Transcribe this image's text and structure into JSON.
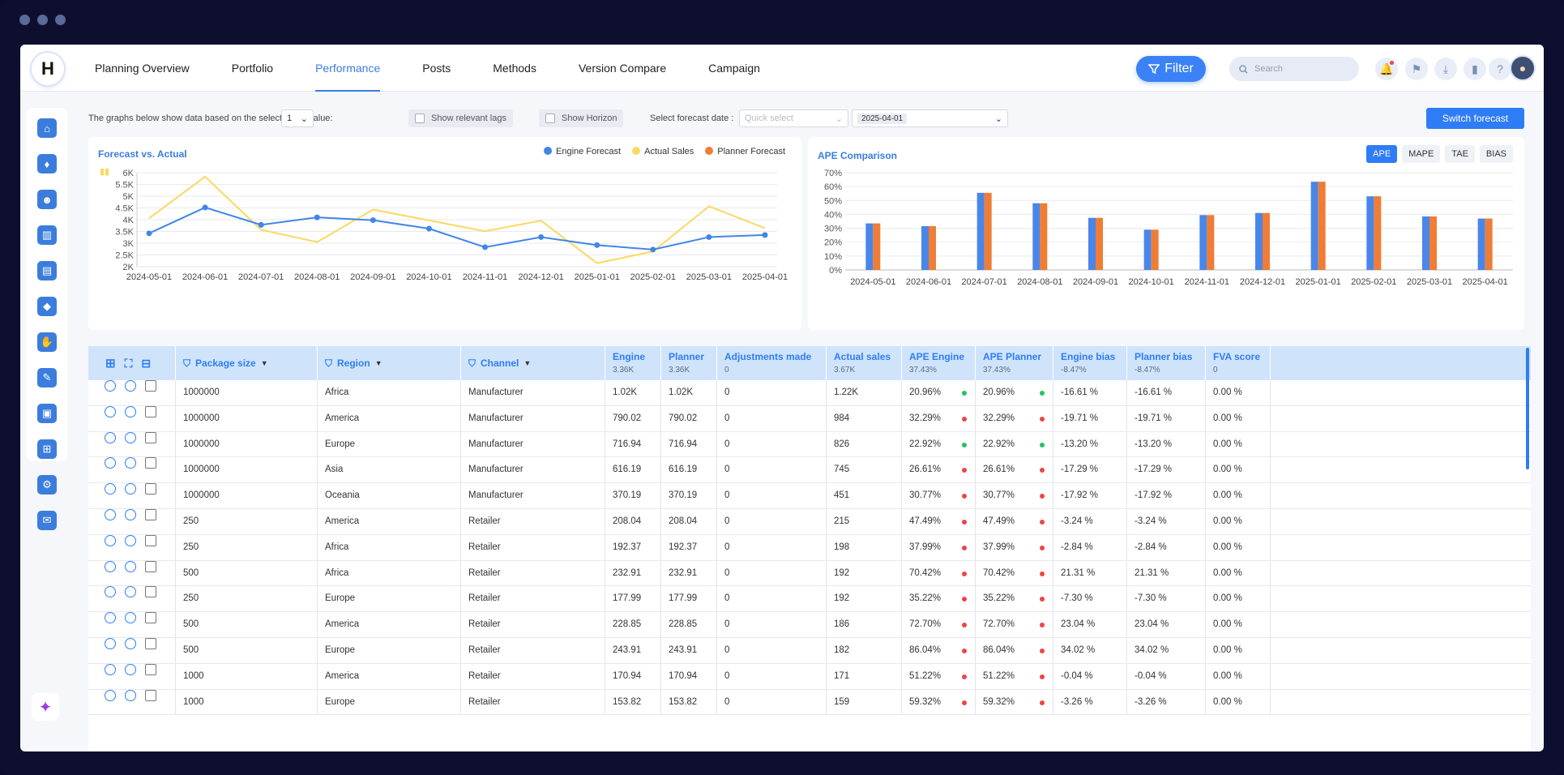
{
  "nav": {
    "logo": "H",
    "tabs": [
      "Planning Overview",
      "Portfolio",
      "Performance",
      "Posts",
      "Methods",
      "Version Compare",
      "Campaign"
    ],
    "active_tab": "Performance",
    "filter_label": "Filter",
    "search_placeholder": "Search"
  },
  "controls": {
    "lag_text": "The graphs below show data based on the selected lag value:",
    "lag_value": "1",
    "show_relevant_lags": "Show relevant lags",
    "show_horizon": "Show Horizon",
    "forecast_date_label": "Select forecast date :",
    "quick_select_placeholder": "Quick select",
    "forecast_date_value": "2025-04-01",
    "switch_forecast": "Switch forecast"
  },
  "forecast_chart": {
    "title": "Forecast vs. Actual",
    "legend": [
      "Engine Forecast",
      "Actual Sales",
      "Planner Forecast"
    ],
    "colors": {
      "engine": "#4086e6",
      "actual": "#fbd862",
      "planner": "#ef7d35"
    }
  },
  "ape_chart": {
    "title": "APE Comparison",
    "tabs": [
      "APE",
      "MAPE",
      "TAE",
      "BIAS"
    ],
    "active_tab": "APE"
  },
  "chart_data": [
    {
      "type": "line",
      "title": "Forecast vs. Actual",
      "x": [
        "2024-05-01",
        "2024-06-01",
        "2024-07-01",
        "2024-08-01",
        "2024-09-01",
        "2024-10-01",
        "2024-11-01",
        "2024-12-01",
        "2025-01-01",
        "2025-02-01",
        "2025-03-01",
        "2025-04-01"
      ],
      "yticks": [
        "2K",
        "2.5K",
        "3K",
        "3.5K",
        "4K",
        "4.5K",
        "5K",
        "5.5K",
        "6K"
      ],
      "ylim": [
        2000,
        6000
      ],
      "series": [
        {
          "name": "Engine Forecast",
          "values": [
            3420,
            4520,
            3780,
            4100,
            3980,
            3620,
            2830,
            3260,
            2920,
            2730,
            3260,
            3350
          ]
        },
        {
          "name": "Actual Sales",
          "values": [
            4060,
            5830,
            3570,
            3050,
            4430,
            3970,
            3510,
            3960,
            2150,
            2650,
            4570,
            3640
          ]
        }
      ]
    },
    {
      "type": "bar",
      "title": "APE Comparison",
      "categories": [
        "2024-05-01",
        "2024-06-01",
        "2024-07-01",
        "2024-08-01",
        "2024-09-01",
        "2024-10-01",
        "2024-11-01",
        "2024-12-01",
        "2025-01-01",
        "2025-02-01",
        "2025-03-01",
        "2025-04-01"
      ],
      "yticks": [
        "0%",
        "10%",
        "20%",
        "30%",
        "40%",
        "50%",
        "60%",
        "70%"
      ],
      "ylim": [
        0,
        70
      ],
      "series": [
        {
          "name": "Engine",
          "values": [
            33.5,
            31.5,
            55.5,
            48,
            37.5,
            29,
            39.5,
            41,
            63.5,
            53,
            38.5,
            37
          ]
        },
        {
          "name": "Planner",
          "values": [
            33.5,
            31.5,
            55.5,
            48,
            37.5,
            29,
            39.5,
            41,
            63.5,
            53,
            38.5,
            37
          ]
        }
      ]
    }
  ],
  "table": {
    "headers": [
      {
        "label": "Package size",
        "sub": ""
      },
      {
        "label": "Region",
        "sub": ""
      },
      {
        "label": "Channel",
        "sub": ""
      },
      {
        "label": "Engine",
        "sub": "3.36K"
      },
      {
        "label": "Planner",
        "sub": "3.36K"
      },
      {
        "label": "Adjustments made",
        "sub": "0"
      },
      {
        "label": "Actual sales",
        "sub": "3.67K"
      },
      {
        "label": "APE Engine",
        "sub": "37.43%"
      },
      {
        "label": "APE Planner",
        "sub": "37.43%"
      },
      {
        "label": "Engine bias",
        "sub": "-8.47%"
      },
      {
        "label": "Planner bias",
        "sub": "-8.47%"
      },
      {
        "label": "FVA score",
        "sub": "0"
      }
    ],
    "rows": [
      [
        "1000000",
        "Africa",
        "Manufacturer",
        "1.02K",
        "1.02K",
        "0",
        "1.22K",
        "20.96%",
        "20.96%",
        "-16.61 %",
        "-16.61 %",
        "0.00 %",
        "g"
      ],
      [
        "1000000",
        "America",
        "Manufacturer",
        "790.02",
        "790.02",
        "0",
        "984",
        "32.29%",
        "32.29%",
        "-19.71 %",
        "-19.71 %",
        "0.00 %",
        "r"
      ],
      [
        "1000000",
        "Europe",
        "Manufacturer",
        "716.94",
        "716.94",
        "0",
        "826",
        "22.92%",
        "22.92%",
        "-13.20 %",
        "-13.20 %",
        "0.00 %",
        "g"
      ],
      [
        "1000000",
        "Asia",
        "Manufacturer",
        "616.19",
        "616.19",
        "0",
        "745",
        "26.61%",
        "26.61%",
        "-17.29 %",
        "-17.29 %",
        "0.00 %",
        "r"
      ],
      [
        "1000000",
        "Oceania",
        "Manufacturer",
        "370.19",
        "370.19",
        "0",
        "451",
        "30.77%",
        "30.77%",
        "-17.92 %",
        "-17.92 %",
        "0.00 %",
        "r"
      ],
      [
        "250",
        "America",
        "Retailer",
        "208.04",
        "208.04",
        "0",
        "215",
        "47.49%",
        "47.49%",
        "-3.24 %",
        "-3.24 %",
        "0.00 %",
        "r"
      ],
      [
        "250",
        "Africa",
        "Retailer",
        "192.37",
        "192.37",
        "0",
        "198",
        "37.99%",
        "37.99%",
        "-2.84 %",
        "-2.84 %",
        "0.00 %",
        "r"
      ],
      [
        "500",
        "Africa",
        "Retailer",
        "232.91",
        "232.91",
        "0",
        "192",
        "70.42%",
        "70.42%",
        "21.31 %",
        "21.31 %",
        "0.00 %",
        "r"
      ],
      [
        "250",
        "Europe",
        "Retailer",
        "177.99",
        "177.99",
        "0",
        "192",
        "35.22%",
        "35.22%",
        "-7.30 %",
        "-7.30 %",
        "0.00 %",
        "r"
      ],
      [
        "500",
        "America",
        "Retailer",
        "228.85",
        "228.85",
        "0",
        "186",
        "72.70%",
        "72.70%",
        "23.04 %",
        "23.04 %",
        "0.00 %",
        "r"
      ],
      [
        "500",
        "Europe",
        "Retailer",
        "243.91",
        "243.91",
        "0",
        "182",
        "86.04%",
        "86.04%",
        "34.02 %",
        "34.02 %",
        "0.00 %",
        "r"
      ],
      [
        "1000",
        "America",
        "Retailer",
        "170.94",
        "170.94",
        "0",
        "171",
        "51.22%",
        "51.22%",
        "-0.04 %",
        "-0.04 %",
        "0.00 %",
        "r"
      ],
      [
        "1000",
        "Europe",
        "Retailer",
        "153.82",
        "153.82",
        "0",
        "159",
        "59.32%",
        "59.32%",
        "-3.26 %",
        "-3.26 %",
        "0.00 %",
        "r"
      ]
    ],
    "status_colors": {
      "g": "#22c55e",
      "r": "#ef4444"
    }
  }
}
